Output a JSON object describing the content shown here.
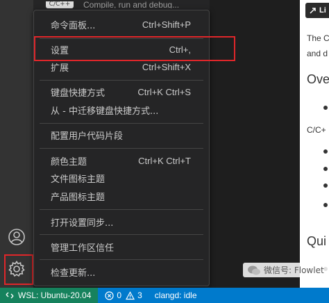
{
  "extension_strip": {
    "badge": "C/C++",
    "description": "Compile, run and debug..."
  },
  "menu": {
    "items": [
      {
        "label": "命令面板...",
        "shortcut": "Ctrl+Shift+P"
      },
      {
        "label": "设置",
        "shortcut": "Ctrl+,"
      },
      {
        "label": "扩展",
        "shortcut": "Ctrl+Shift+X"
      },
      {
        "label": "键盘快捷方式",
        "shortcut": "Ctrl+K Ctrl+S"
      },
      {
        "label": "从 - 中迁移键盘快捷方式...",
        "shortcut": ""
      },
      {
        "label": "配置用户代码片段",
        "shortcut": ""
      },
      {
        "label": "颜色主题",
        "shortcut": "Ctrl+K Ctrl+T"
      },
      {
        "label": "文件图标主题",
        "shortcut": ""
      },
      {
        "label": "产品图标主题",
        "shortcut": ""
      },
      {
        "label": "打开设置同步...",
        "shortcut": ""
      },
      {
        "label": "管理工作区信任",
        "shortcut": ""
      },
      {
        "label": "检查更新...",
        "shortcut": ""
      }
    ]
  },
  "doc_panel": {
    "button_label": "Li",
    "line1": "The C",
    "line2": "and d",
    "heading1": "Ove",
    "line3": "C/C+",
    "heading2": "Qui"
  },
  "status_bar": {
    "remote": "WSL: Ubuntu-20.04",
    "errors": "0",
    "warnings": "3",
    "language_server": "clangd: idle"
  },
  "watermark": {
    "text": "微信号: Flowlet"
  },
  "colors": {
    "highlight": "#e0262a",
    "status_bar": "#007acc",
    "remote_indicator": "#16825d",
    "menu_bg": "#252526"
  }
}
